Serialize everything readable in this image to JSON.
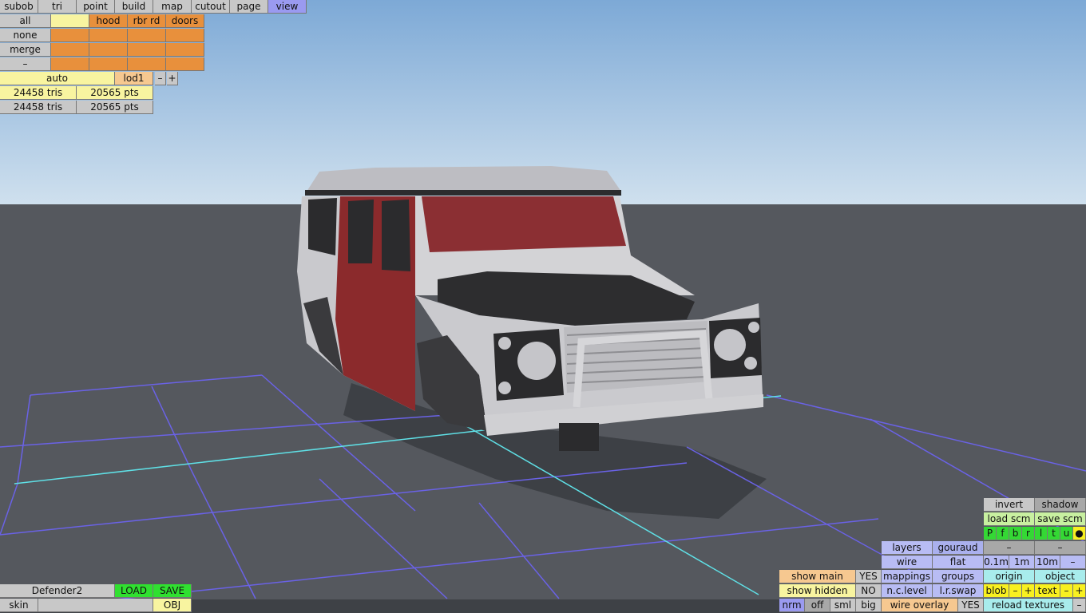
{
  "menu": {
    "items": [
      "subob",
      "tri",
      "point",
      "build",
      "map",
      "cutout",
      "page",
      "view"
    ],
    "active": "view"
  },
  "groups": {
    "all": "all",
    "none": "none",
    "merge": "merge",
    "minus": "–",
    "col_yellow": "",
    "hood": "hood",
    "rbr_rd": "rbr rd",
    "doors": "doors"
  },
  "lod": {
    "auto": "auto",
    "lod": "lod1",
    "minus": "–",
    "plus": "+"
  },
  "stats": {
    "row1_tris": "24458 tris",
    "row1_pts": "20565 pts",
    "row2_tris": "24458 tris",
    "row2_pts": "20565 pts"
  },
  "file": {
    "name": "Defender2",
    "load": "LOAD",
    "save": "SAVE",
    "skin": "skin",
    "skin_value": "",
    "obj": "OBJ"
  },
  "display": {
    "show_main": "show main",
    "show_main_val": "YES",
    "show_hidden": "show hidden",
    "show_hidden_val": "NO",
    "nrm": "nrm",
    "off": "off",
    "sml": "sml",
    "big": "big"
  },
  "render": {
    "layers": "layers",
    "gouraud": "gouraud",
    "wire": "wire",
    "flat": "flat",
    "mappings": "mappings",
    "groups": "groups",
    "nc_level": "n.c.level",
    "lr_swap": "l.r.swap",
    "wire_overlay": "wire overlay",
    "wire_overlay_val": "YES"
  },
  "right": {
    "invert": "invert",
    "shadow": "shadow",
    "load_scm": "load scm",
    "save_scm": "save scm",
    "flags": [
      "P",
      "f",
      "b",
      "r",
      "l",
      "t",
      "u",
      "●"
    ],
    "minus_a": "–",
    "minus_b": "–",
    "grid_01": "0.1m",
    "grid_1": "1m",
    "grid_10": "10m",
    "grid_minus": "–",
    "origin": "origin",
    "object": "object",
    "blob": "blob",
    "blob_minus": "–",
    "blob_plus": "+",
    "text": "text",
    "text_minus": "–",
    "text_plus": "+",
    "reload": "reload textures",
    "reload_minus": "–"
  }
}
